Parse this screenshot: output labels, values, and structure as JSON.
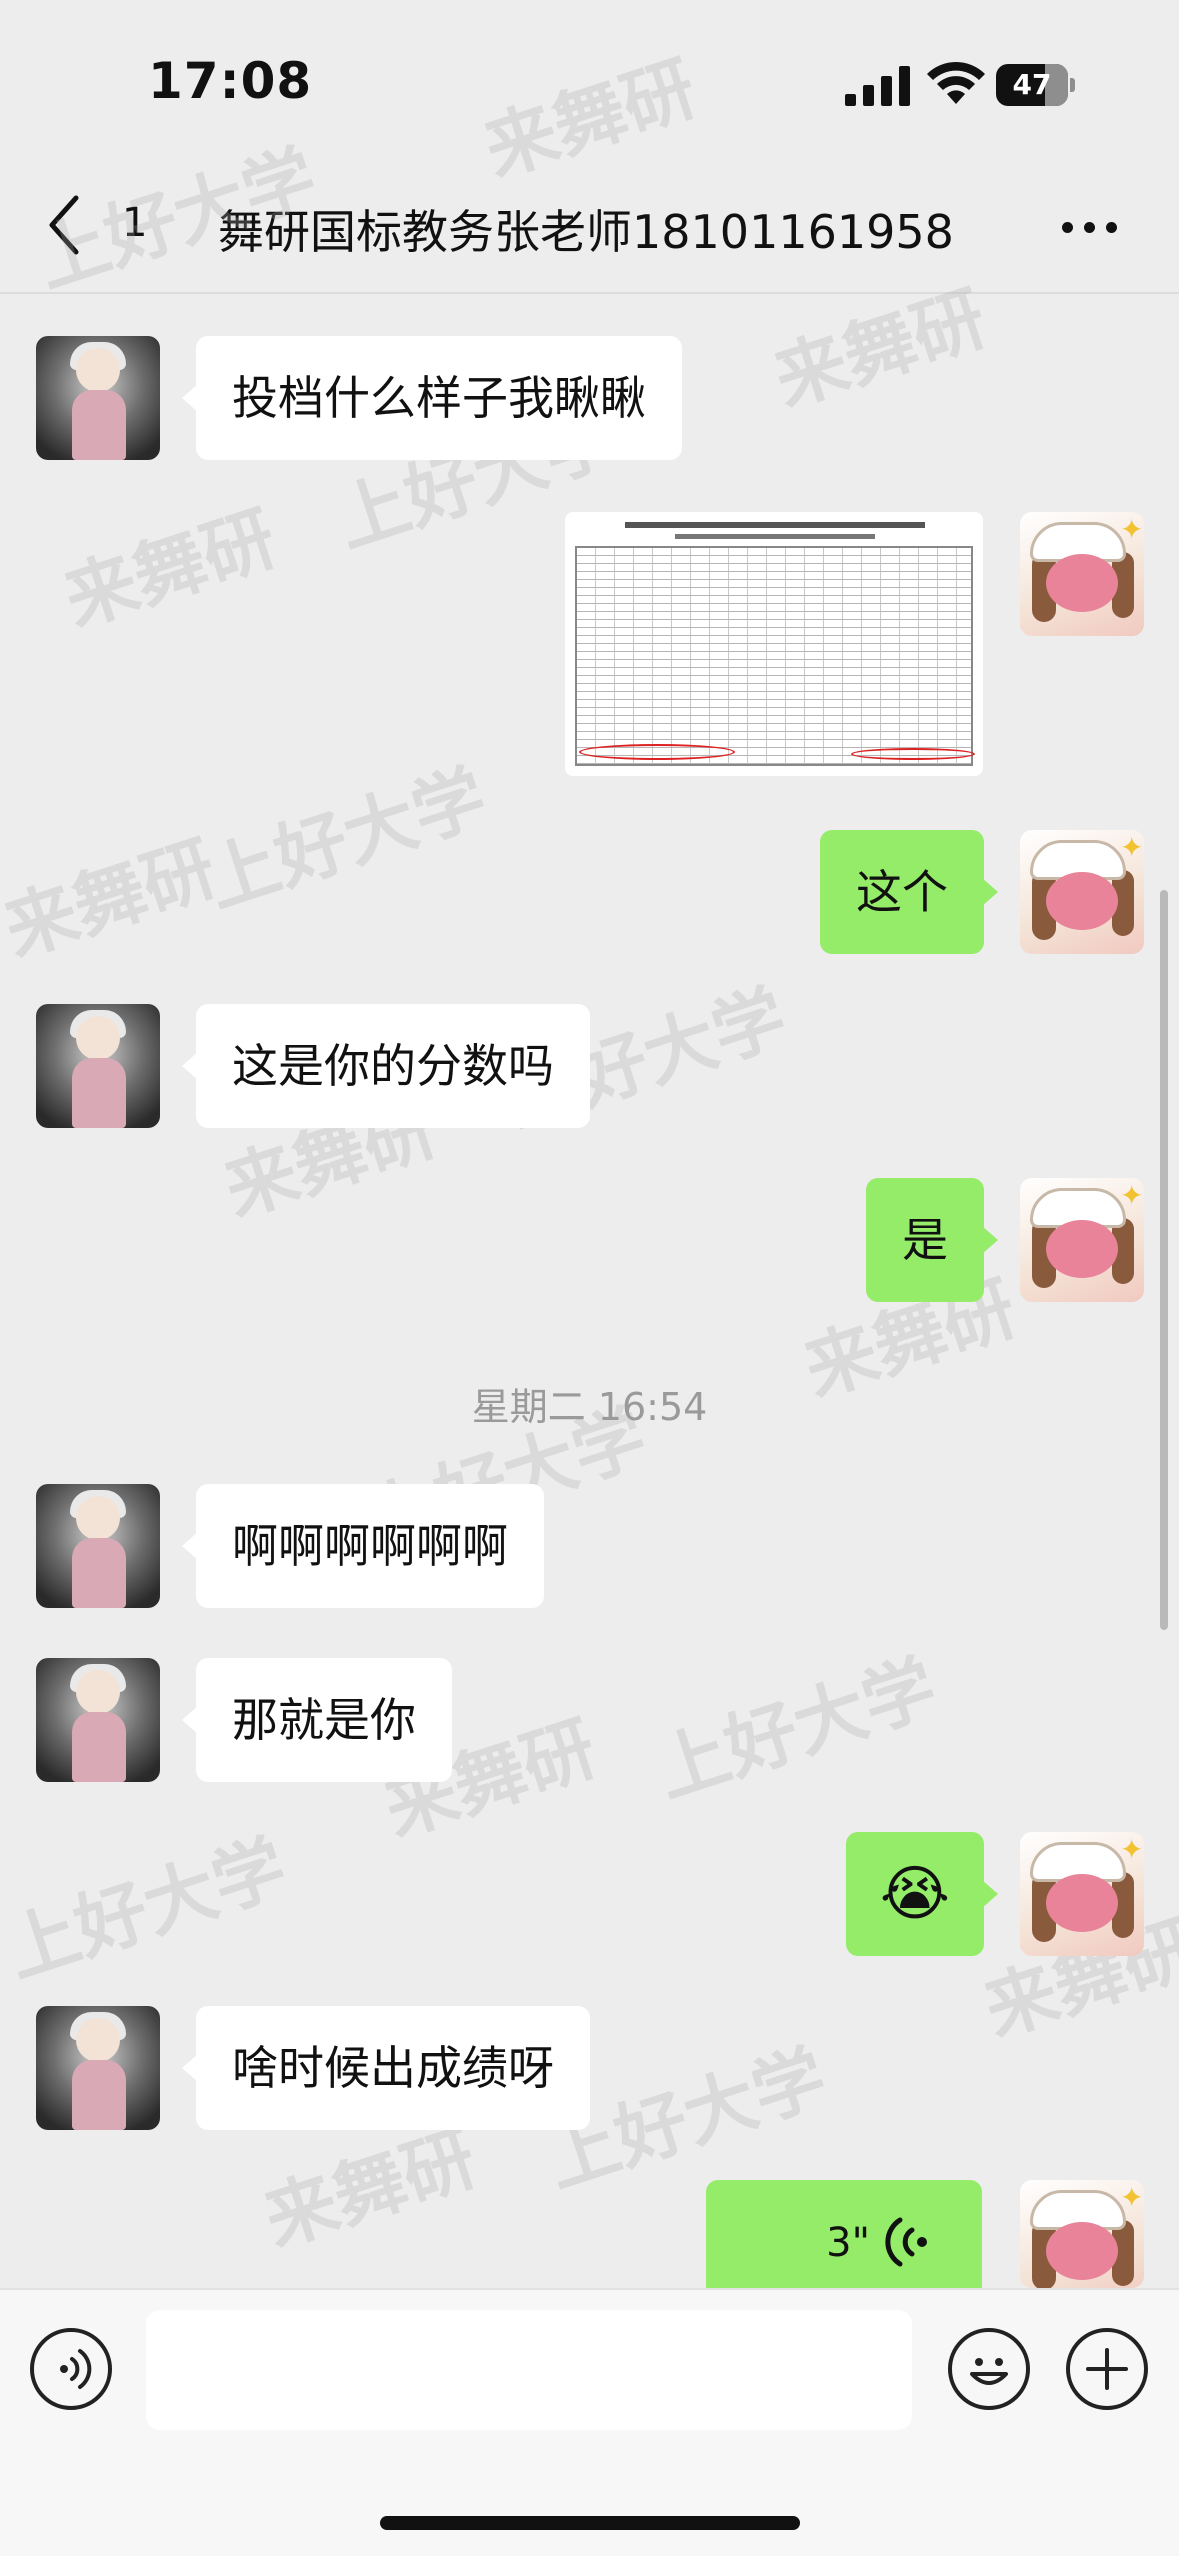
{
  "status_bar": {
    "time": "17:08",
    "battery": "47"
  },
  "nav": {
    "unread_count": "1",
    "title": "舞研国标教务张老师18101161958",
    "back_icon": "chevron-left-icon",
    "more_icon": "more-dots-icon"
  },
  "messages": [
    {
      "side": "left",
      "type": "text",
      "text": "投档什么样子我瞅瞅"
    },
    {
      "side": "right",
      "type": "image"
    },
    {
      "side": "right",
      "type": "text",
      "text": "这个"
    },
    {
      "side": "left",
      "type": "text",
      "text": "这是你的分数吗"
    },
    {
      "side": "right",
      "type": "text",
      "text": "是"
    },
    {
      "side": "left",
      "type": "text",
      "text": "啊啊啊啊啊啊"
    },
    {
      "side": "left",
      "type": "text",
      "text": "那就是你"
    },
    {
      "side": "right",
      "type": "emoji",
      "text": "😭"
    },
    {
      "side": "left",
      "type": "text",
      "text": "啥时候出成绩呀"
    },
    {
      "side": "right",
      "type": "voice",
      "text": "3\""
    }
  ],
  "timestamp": "星期二 16:54",
  "watermarks": [
    "来舞研",
    "上好大学"
  ],
  "colors": {
    "background": "#ededed",
    "bubble_self": "#95ec69",
    "bubble_other": "#ffffff"
  },
  "input_bar": {
    "voice_icon": "voice-input-icon",
    "emoji_icon": "emoji-icon",
    "plus_icon": "plus-icon"
  }
}
